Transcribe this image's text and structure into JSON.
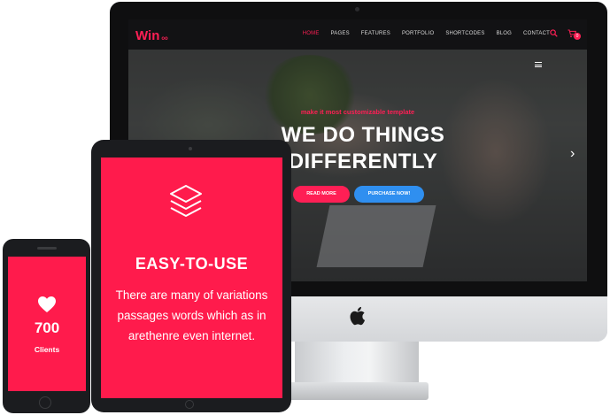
{
  "desktop": {
    "logo": "Win",
    "logo_suffix": "oo",
    "nav_items": [
      "HOME",
      "PAGES",
      "FEATURES",
      "PORTFOLIO",
      "SHORTCODES",
      "BLOG",
      "CONTACT"
    ],
    "active_nav": "HOME",
    "cart_count": "0",
    "hero_kicker": "make it most customizable template",
    "hero_title": "WE DO THINGS DIFFERENTLY",
    "read_more": "READ MORE",
    "purchase": "PURCHASE NOW!"
  },
  "tablet": {
    "icon": "layers-icon",
    "title": "EASY-TO-USE",
    "text": "There are many of variations passages words which as in arethenre even internet."
  },
  "phone": {
    "icon": "heart-icon",
    "count": "700",
    "label": "Clients"
  },
  "colors": {
    "accent": "#ff1b4c",
    "button_blue": "#2f8ff0",
    "nav_bg": "#121214",
    "device_dark": "#1b1c1f"
  }
}
